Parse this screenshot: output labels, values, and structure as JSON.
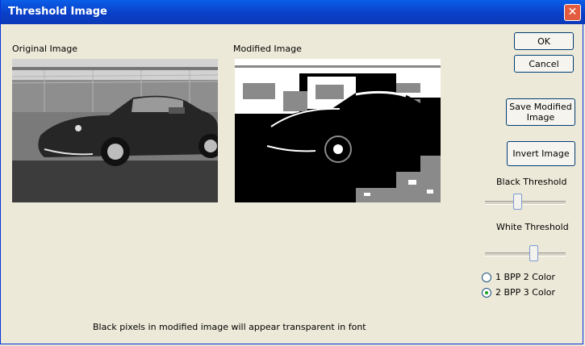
{
  "window": {
    "title": "Threshold Image",
    "close_glyph": "✕"
  },
  "labels": {
    "original": "Original Image",
    "modified": "Modified Image",
    "note": "Black pixels in modified image will appear transparent in font"
  },
  "buttons": {
    "ok": "OK",
    "cancel": "Cancel",
    "save_modified": "Save Modified Image",
    "invert": "Invert Image"
  },
  "sliders": {
    "black": {
      "label": "Black Threshold",
      "value": 0.4
    },
    "white": {
      "label": "White Threshold",
      "value": 0.6
    }
  },
  "radios": [
    {
      "label": "1 BPP 2 Color",
      "checked": false
    },
    {
      "label": "2 BPP 3 Color",
      "checked": true
    }
  ]
}
